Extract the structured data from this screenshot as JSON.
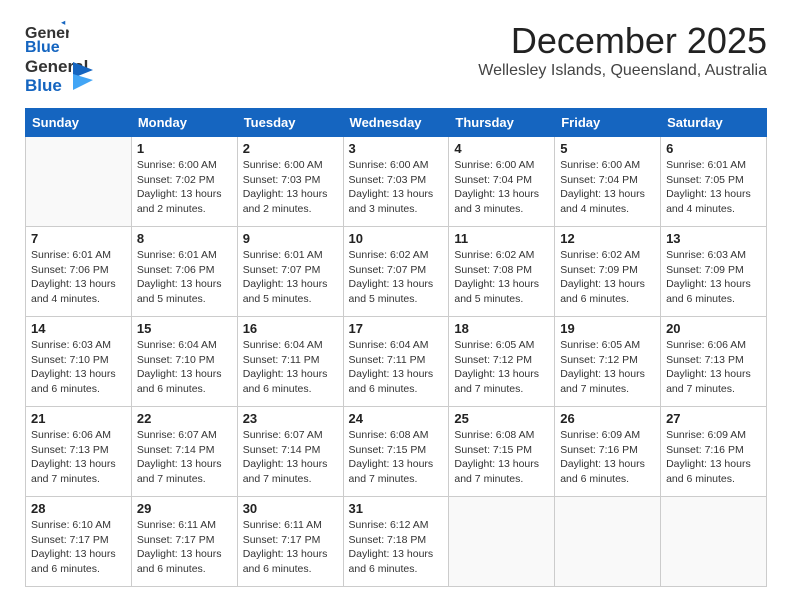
{
  "logo": {
    "line1": "General",
    "line2": "Blue"
  },
  "title": "December 2025",
  "subtitle": "Wellesley Islands, Queensland, Australia",
  "days_of_week": [
    "Sunday",
    "Monday",
    "Tuesday",
    "Wednesday",
    "Thursday",
    "Friday",
    "Saturday"
  ],
  "weeks": [
    [
      {
        "day": "",
        "info": ""
      },
      {
        "day": "1",
        "info": "Sunrise: 6:00 AM\nSunset: 7:02 PM\nDaylight: 13 hours\nand 2 minutes."
      },
      {
        "day": "2",
        "info": "Sunrise: 6:00 AM\nSunset: 7:03 PM\nDaylight: 13 hours\nand 2 minutes."
      },
      {
        "day": "3",
        "info": "Sunrise: 6:00 AM\nSunset: 7:03 PM\nDaylight: 13 hours\nand 3 minutes."
      },
      {
        "day": "4",
        "info": "Sunrise: 6:00 AM\nSunset: 7:04 PM\nDaylight: 13 hours\nand 3 minutes."
      },
      {
        "day": "5",
        "info": "Sunrise: 6:00 AM\nSunset: 7:04 PM\nDaylight: 13 hours\nand 4 minutes."
      },
      {
        "day": "6",
        "info": "Sunrise: 6:01 AM\nSunset: 7:05 PM\nDaylight: 13 hours\nand 4 minutes."
      }
    ],
    [
      {
        "day": "7",
        "info": "Sunrise: 6:01 AM\nSunset: 7:06 PM\nDaylight: 13 hours\nand 4 minutes."
      },
      {
        "day": "8",
        "info": "Sunrise: 6:01 AM\nSunset: 7:06 PM\nDaylight: 13 hours\nand 5 minutes."
      },
      {
        "day": "9",
        "info": "Sunrise: 6:01 AM\nSunset: 7:07 PM\nDaylight: 13 hours\nand 5 minutes."
      },
      {
        "day": "10",
        "info": "Sunrise: 6:02 AM\nSunset: 7:07 PM\nDaylight: 13 hours\nand 5 minutes."
      },
      {
        "day": "11",
        "info": "Sunrise: 6:02 AM\nSunset: 7:08 PM\nDaylight: 13 hours\nand 5 minutes."
      },
      {
        "day": "12",
        "info": "Sunrise: 6:02 AM\nSunset: 7:09 PM\nDaylight: 13 hours\nand 6 minutes."
      },
      {
        "day": "13",
        "info": "Sunrise: 6:03 AM\nSunset: 7:09 PM\nDaylight: 13 hours\nand 6 minutes."
      }
    ],
    [
      {
        "day": "14",
        "info": "Sunrise: 6:03 AM\nSunset: 7:10 PM\nDaylight: 13 hours\nand 6 minutes."
      },
      {
        "day": "15",
        "info": "Sunrise: 6:04 AM\nSunset: 7:10 PM\nDaylight: 13 hours\nand 6 minutes."
      },
      {
        "day": "16",
        "info": "Sunrise: 6:04 AM\nSunset: 7:11 PM\nDaylight: 13 hours\nand 6 minutes."
      },
      {
        "day": "17",
        "info": "Sunrise: 6:04 AM\nSunset: 7:11 PM\nDaylight: 13 hours\nand 6 minutes."
      },
      {
        "day": "18",
        "info": "Sunrise: 6:05 AM\nSunset: 7:12 PM\nDaylight: 13 hours\nand 7 minutes."
      },
      {
        "day": "19",
        "info": "Sunrise: 6:05 AM\nSunset: 7:12 PM\nDaylight: 13 hours\nand 7 minutes."
      },
      {
        "day": "20",
        "info": "Sunrise: 6:06 AM\nSunset: 7:13 PM\nDaylight: 13 hours\nand 7 minutes."
      }
    ],
    [
      {
        "day": "21",
        "info": "Sunrise: 6:06 AM\nSunset: 7:13 PM\nDaylight: 13 hours\nand 7 minutes."
      },
      {
        "day": "22",
        "info": "Sunrise: 6:07 AM\nSunset: 7:14 PM\nDaylight: 13 hours\nand 7 minutes."
      },
      {
        "day": "23",
        "info": "Sunrise: 6:07 AM\nSunset: 7:14 PM\nDaylight: 13 hours\nand 7 minutes."
      },
      {
        "day": "24",
        "info": "Sunrise: 6:08 AM\nSunset: 7:15 PM\nDaylight: 13 hours\nand 7 minutes."
      },
      {
        "day": "25",
        "info": "Sunrise: 6:08 AM\nSunset: 7:15 PM\nDaylight: 13 hours\nand 7 minutes."
      },
      {
        "day": "26",
        "info": "Sunrise: 6:09 AM\nSunset: 7:16 PM\nDaylight: 13 hours\nand 6 minutes."
      },
      {
        "day": "27",
        "info": "Sunrise: 6:09 AM\nSunset: 7:16 PM\nDaylight: 13 hours\nand 6 minutes."
      }
    ],
    [
      {
        "day": "28",
        "info": "Sunrise: 6:10 AM\nSunset: 7:17 PM\nDaylight: 13 hours\nand 6 minutes."
      },
      {
        "day": "29",
        "info": "Sunrise: 6:11 AM\nSunset: 7:17 PM\nDaylight: 13 hours\nand 6 minutes."
      },
      {
        "day": "30",
        "info": "Sunrise: 6:11 AM\nSunset: 7:17 PM\nDaylight: 13 hours\nand 6 minutes."
      },
      {
        "day": "31",
        "info": "Sunrise: 6:12 AM\nSunset: 7:18 PM\nDaylight: 13 hours\nand 6 minutes."
      },
      {
        "day": "",
        "info": ""
      },
      {
        "day": "",
        "info": ""
      },
      {
        "day": "",
        "info": ""
      }
    ]
  ]
}
